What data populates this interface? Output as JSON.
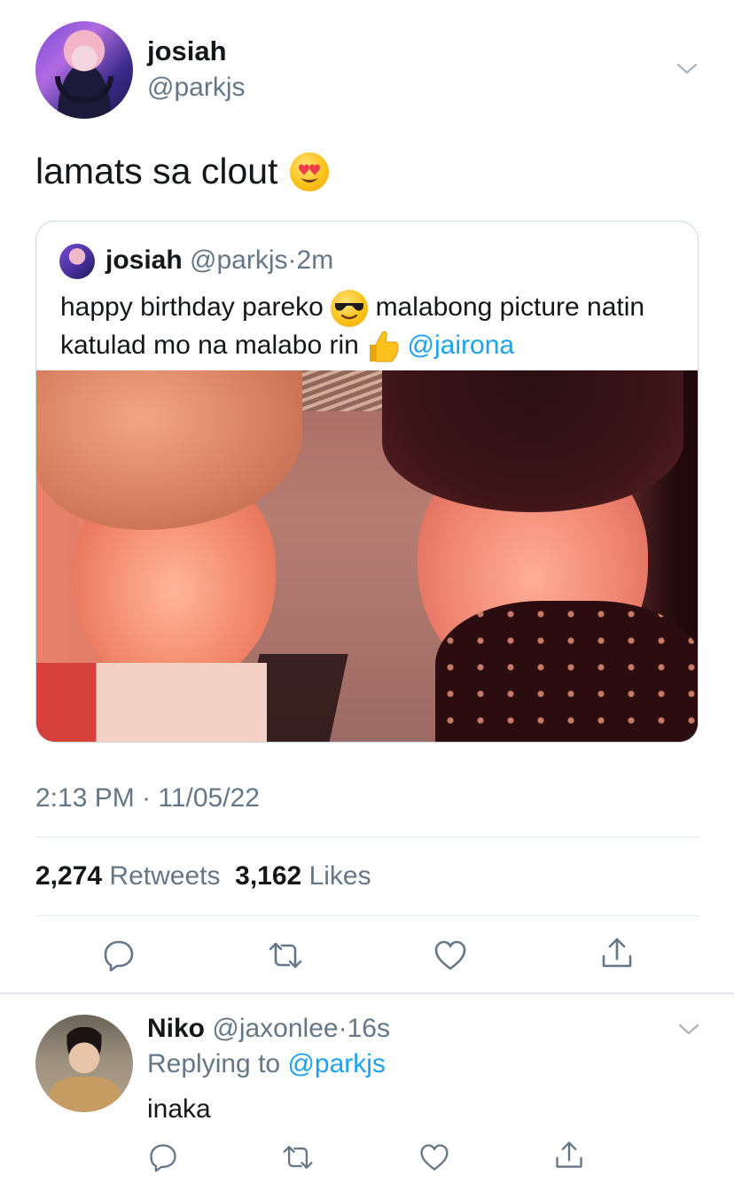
{
  "main_tweet": {
    "display_name": "josiah",
    "handle": "@parkjs",
    "text": "lamats sa clout",
    "text_emoji": "smiling-face-with-heart-eyes-emoji",
    "timestamp": "2:13 PM · 11/05/22",
    "retweets_count": "2,274",
    "retweets_label": "Retweets",
    "likes_count": "3,162",
    "likes_label": "Likes"
  },
  "quoted_tweet": {
    "display_name": "josiah",
    "handle": "@parkjs",
    "separator": "·",
    "time": "2m",
    "text_part1": "happy birthday pareko",
    "emoji1": "smiling-face-with-sunglasses-emoji",
    "text_part2": "malabong picture natin katulad mo na malabo rin",
    "emoji2": "thumbs-up-emoji",
    "mention": "@jairona"
  },
  "reply": {
    "display_name": "Niko",
    "handle": "@jaxonlee",
    "separator": "·",
    "time": "16s",
    "replying_label": "Replying to",
    "replying_to": "@parkjs",
    "text": "inaka"
  },
  "actions": [
    "reply-icon",
    "retweet-icon",
    "like-icon",
    "share-icon"
  ],
  "colors": {
    "text_primary": "#14171a",
    "text_secondary": "#657786",
    "link": "#1da1f2",
    "divider": "#e1e8ed"
  }
}
